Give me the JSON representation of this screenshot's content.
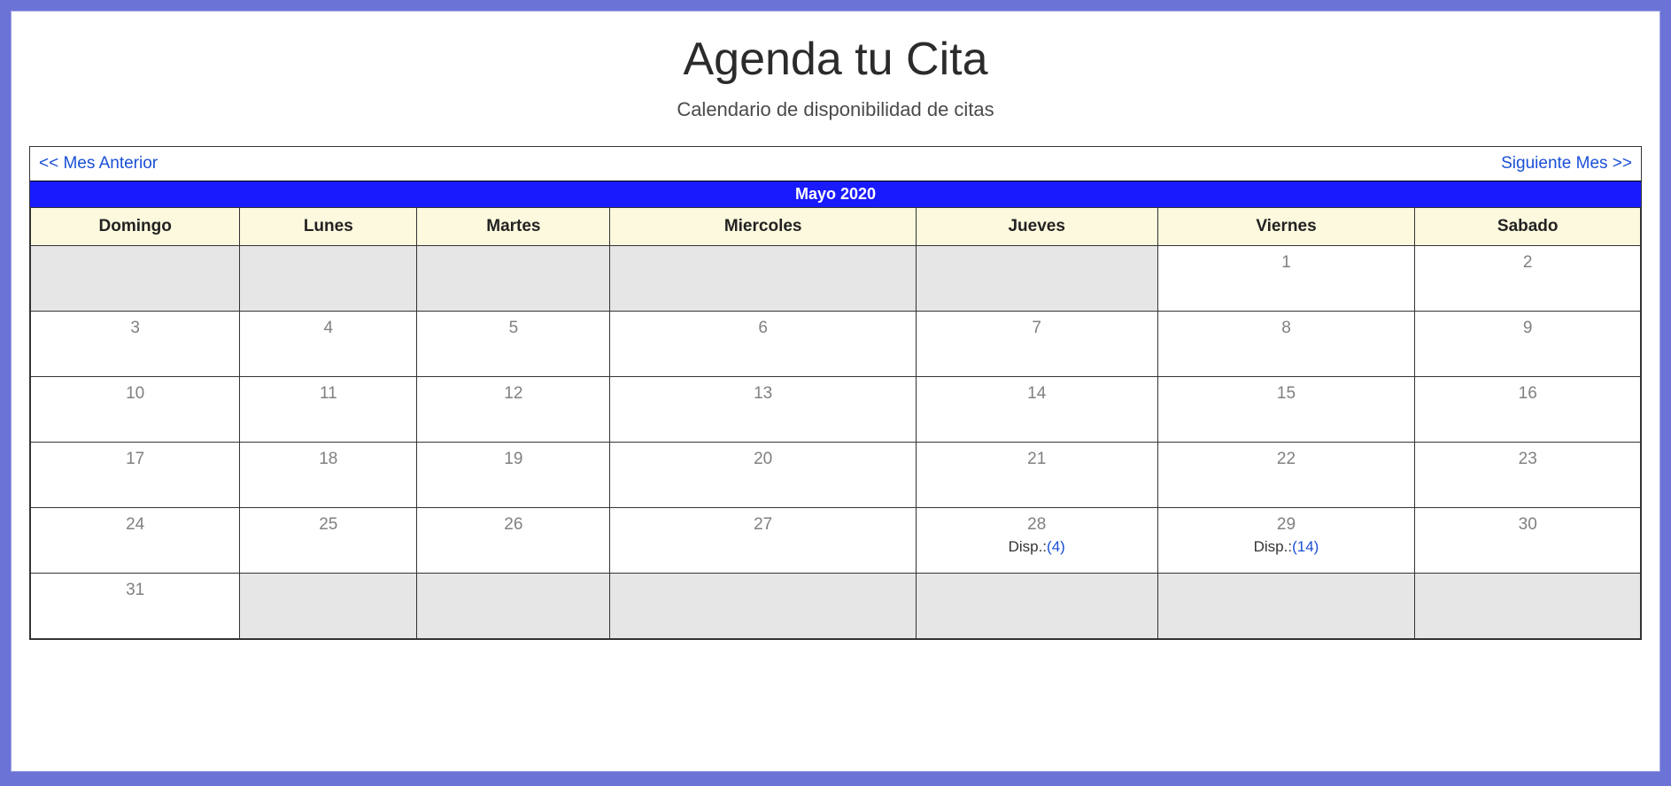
{
  "header": {
    "title": "Agenda tu Cita",
    "subtitle": "Calendario de disponibilidad de citas"
  },
  "nav": {
    "prev": "<< Mes Anterior",
    "next": "Siguiente Mes >>"
  },
  "month_label": "Mayo 2020",
  "day_headers": [
    "Domingo",
    "Lunes",
    "Martes",
    "Miercoles",
    "Jueves",
    "Viernes",
    "Sabado"
  ],
  "disp_prefix": "Disp.:",
  "weeks": [
    [
      {
        "day": null
      },
      {
        "day": null
      },
      {
        "day": null
      },
      {
        "day": null
      },
      {
        "day": null
      },
      {
        "day": "1"
      },
      {
        "day": "2"
      }
    ],
    [
      {
        "day": "3"
      },
      {
        "day": "4"
      },
      {
        "day": "5"
      },
      {
        "day": "6"
      },
      {
        "day": "7"
      },
      {
        "day": "8"
      },
      {
        "day": "9"
      }
    ],
    [
      {
        "day": "10"
      },
      {
        "day": "11"
      },
      {
        "day": "12"
      },
      {
        "day": "13"
      },
      {
        "day": "14"
      },
      {
        "day": "15"
      },
      {
        "day": "16"
      }
    ],
    [
      {
        "day": "17"
      },
      {
        "day": "18"
      },
      {
        "day": "19"
      },
      {
        "day": "20"
      },
      {
        "day": "21"
      },
      {
        "day": "22"
      },
      {
        "day": "23"
      }
    ],
    [
      {
        "day": "24"
      },
      {
        "day": "25"
      },
      {
        "day": "26"
      },
      {
        "day": "27"
      },
      {
        "day": "28",
        "disp": "(4)"
      },
      {
        "day": "29",
        "disp": "(14)"
      },
      {
        "day": "30"
      }
    ],
    [
      {
        "day": "31"
      },
      {
        "day": null
      },
      {
        "day": null
      },
      {
        "day": null
      },
      {
        "day": null
      },
      {
        "day": null
      },
      {
        "day": null
      }
    ]
  ]
}
